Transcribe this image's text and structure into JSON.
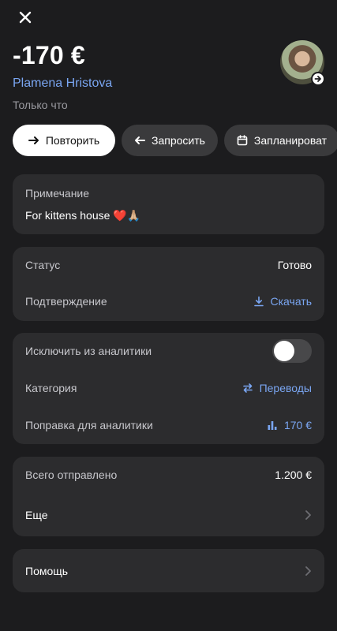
{
  "header": {
    "close_icon": "close-icon",
    "amount": "-170 €",
    "payee": "Plamena Hristova",
    "time": "Только что"
  },
  "actions": {
    "repeat_label": "Повторить",
    "request_label": "Запросить",
    "schedule_label": "Запланироват"
  },
  "note": {
    "label": "Примечание",
    "text": "For kittens house ❤️🙏🏼"
  },
  "status_card": {
    "status_label": "Статус",
    "status_value": "Готово",
    "confirmation_label": "Подтверждение",
    "download_label": "Скачать"
  },
  "analytics_card": {
    "exclude_label": "Исключить из аналитики",
    "exclude_on": false,
    "category_label": "Категория",
    "category_value": "Переводы",
    "adjustment_label": "Поправка для аналитики",
    "adjustment_value": "170 €"
  },
  "total_card": {
    "total_label": "Всего отправлено",
    "total_value": "1.200 €",
    "more_label": "Еще"
  },
  "help_card": {
    "help_label": "Помощь"
  },
  "colors": {
    "background": "#1c1c1e",
    "card": "#2c2c2e",
    "accent_blue": "#7aa6f2"
  }
}
